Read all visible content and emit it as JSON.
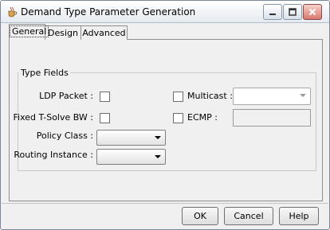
{
  "window": {
    "title": "Demand Type Parameter Generation"
  },
  "tabs": [
    {
      "label": "General"
    },
    {
      "label": "Design"
    },
    {
      "label": "Advanced"
    }
  ],
  "group": {
    "title": "Type Fields"
  },
  "fields": {
    "ldp_packet": {
      "label": "LDP Packet :"
    },
    "fixed_tsolve": {
      "label": "Fixed T-Solve BW :"
    },
    "policy_class": {
      "label": "Policy Class :",
      "value": ""
    },
    "routing_instance": {
      "label": "Routing Instance :",
      "value": ""
    },
    "multicast": {
      "label": "Multicast :",
      "value": ""
    },
    "ecmp": {
      "label": "ECMP :",
      "value": ""
    }
  },
  "buttons": {
    "ok": "OK",
    "cancel": "Cancel",
    "help": "Help"
  },
  "icons": {
    "app": "java-cup-icon",
    "minimize": "minimize-icon",
    "maximize": "maximize-icon",
    "close": "close-icon"
  },
  "colors": {
    "accent": "#4f7aa8",
    "background": "#f0f0f0"
  }
}
